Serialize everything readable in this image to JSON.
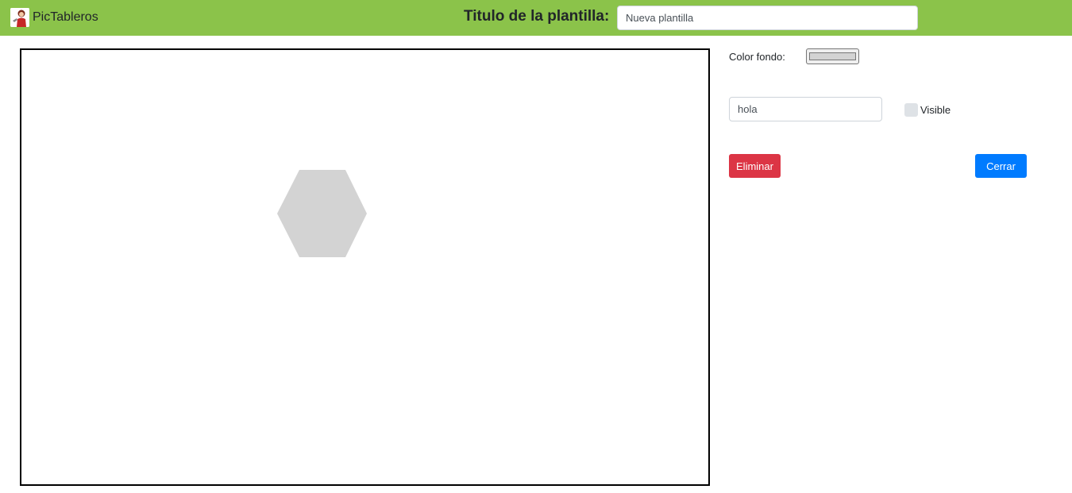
{
  "brand": {
    "name": "PicTableros",
    "logo_icon": "user-avatar-icon"
  },
  "header": {
    "title_label": "Titulo de la plantilla:",
    "title_value": "Nueva plantilla"
  },
  "canvas": {
    "shape": "hexagon",
    "shape_color": "#d3d3d3"
  },
  "panel": {
    "bg_color_label": "Color fondo:",
    "bg_color_value": "#d3d3d3",
    "text_value": "hola",
    "visible_label": "Visible",
    "visible_checked": false,
    "delete_label": "Eliminar",
    "close_label": "Cerrar"
  },
  "colors": {
    "navbar": "#8bc34a",
    "danger": "#dc3545",
    "primary": "#007bff"
  }
}
